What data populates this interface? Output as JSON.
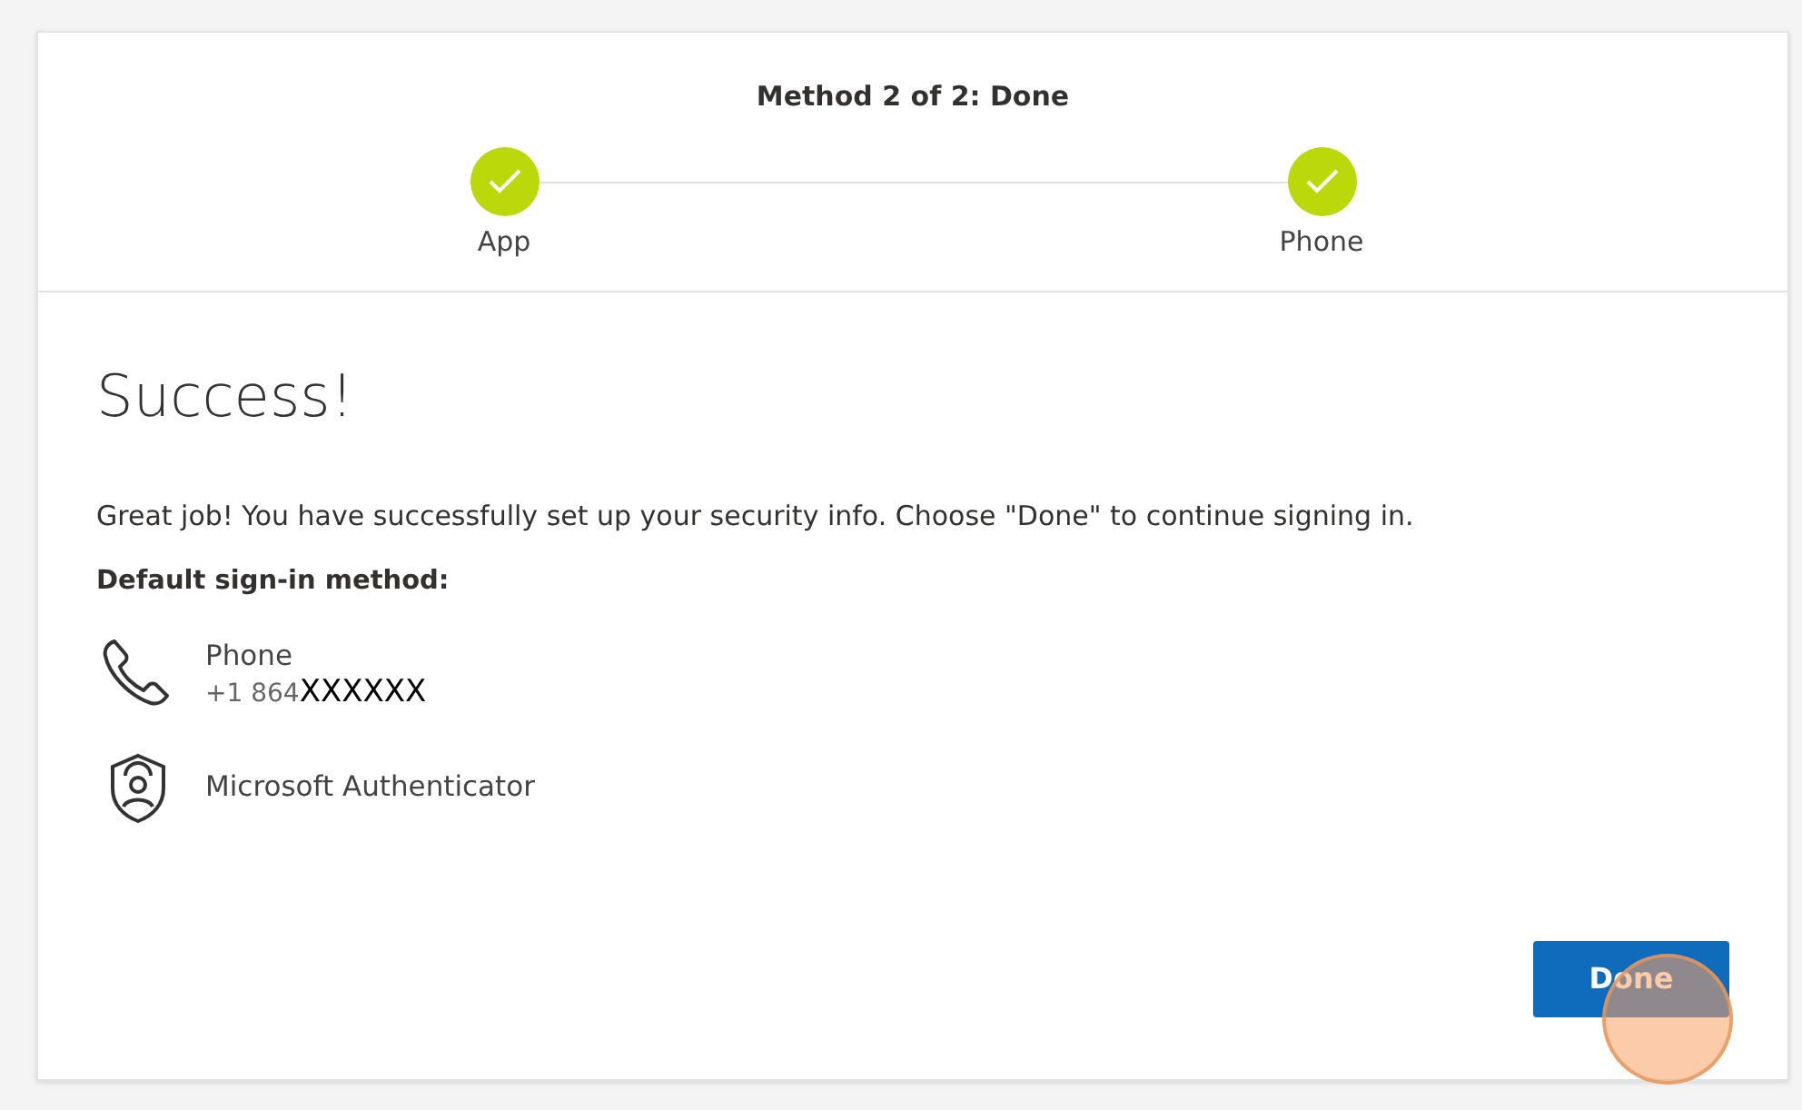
{
  "progress": {
    "title": "Method 2 of 2: Done",
    "steps": [
      {
        "label": "App",
        "completed": true
      },
      {
        "label": "Phone",
        "completed": true
      }
    ]
  },
  "heading": "Success!",
  "message": "Great job! You have successfully set up your security info. Choose \"Done\" to continue signing in.",
  "default_label": "Default sign-in method:",
  "methods": [
    {
      "kind": "phone",
      "name": "Phone",
      "detail": "+1 864",
      "redaction": "XXXXXX"
    },
    {
      "kind": "authenticator",
      "name": "Microsoft Authenticator"
    }
  ],
  "done_button": {
    "label": "Done",
    "click_highlight": true
  }
}
